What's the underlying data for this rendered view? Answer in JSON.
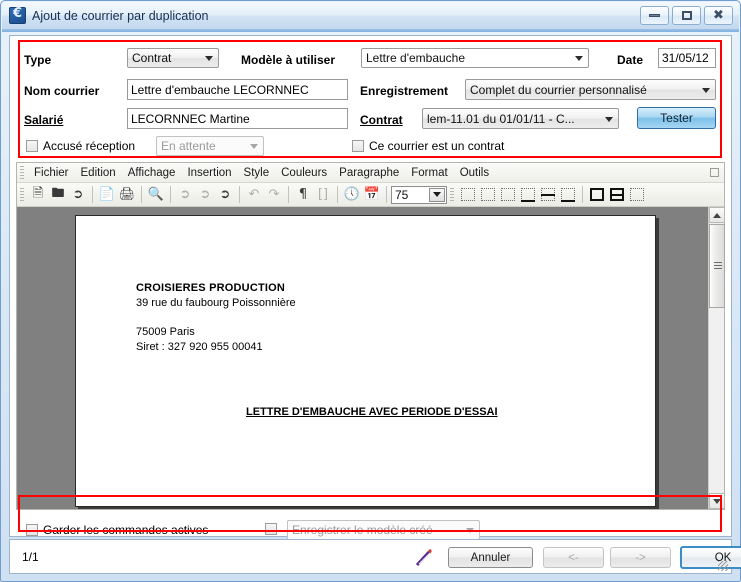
{
  "window": {
    "title": "Ajout de courrier par duplication",
    "icon": "app-euro-icon",
    "buttons": {
      "minimize": "minimize-icon",
      "maximize": "maximize-icon",
      "close": "close-icon"
    }
  },
  "form": {
    "type_label": "Type",
    "type_value": "Contrat",
    "modele_label": "Modèle à utiliser",
    "modele_value": "Lettre d'embauche",
    "date_label": "Date",
    "date_value": "31/05/12",
    "nom_courrier_label": "Nom courrier",
    "nom_courrier_value": "Lettre d'embauche LECORNNEC",
    "enregistrement_label": "Enregistrement",
    "enregistrement_value": "Complet du courrier personnalisé",
    "salarie_label": "Salarié",
    "salarie_value": "LECORNNEC Martine",
    "contrat_label": "Contrat",
    "contrat_value": "lem-11.01 du 01/01/11 - C...",
    "tester_label": "Tester",
    "accuse_label": "Accusé réception",
    "accuse_status": "En attente",
    "ce_courrier_label": "Ce courrier est un contrat"
  },
  "editor": {
    "menu": [
      "Fichier",
      "Edition",
      "Affichage",
      "Insertion",
      "Style",
      "Couleurs",
      "Paragraphe",
      "Format",
      "Outils"
    ],
    "toolbar": {
      "zoom_value": "75",
      "icons": [
        "new-document-icon",
        "open-folder-icon",
        "save-icon",
        "print-preview-icon",
        "print-icon",
        "zoom-search-icon",
        "cut-icon",
        "copy-icon",
        "paste-icon",
        "undo-icon",
        "redo-icon",
        "paragraph-mark-icon",
        "field-brackets-icon",
        "clock-icon",
        "calendar-icon"
      ],
      "border_buttons": [
        "border-none-icon",
        "border-box-icon",
        "border-left-right-icon",
        "border-bottom-icon",
        "border-top-middle-icon",
        "border-bottom-middle-icon",
        "frame-outline-icon",
        "frame-split-icon",
        "frame-dotted-icon"
      ]
    },
    "document": {
      "company": "CROISIERES PRODUCTION",
      "address": "39 rue du faubourg Poissonnière",
      "city": "75009 Paris",
      "siret": "Siret : 327 920 955 00041",
      "title": "LETTRE D'EMBAUCHE AVEC PERIODE D'ESSAI"
    }
  },
  "bottom": {
    "garder_label": "Garder les commandes actives",
    "enregistrer_modele_label": "Enregistrer le modèle créé"
  },
  "status": {
    "page": "1/1",
    "pen_icon": "pen-signature-icon",
    "cancel_label": "Annuler",
    "prev_label": "<-",
    "next_label": "->",
    "ok_label": "OK"
  },
  "colors": {
    "highlight": "#ff0000",
    "accent": "#7cc0ea",
    "window_frame": "#6f9dd0"
  }
}
